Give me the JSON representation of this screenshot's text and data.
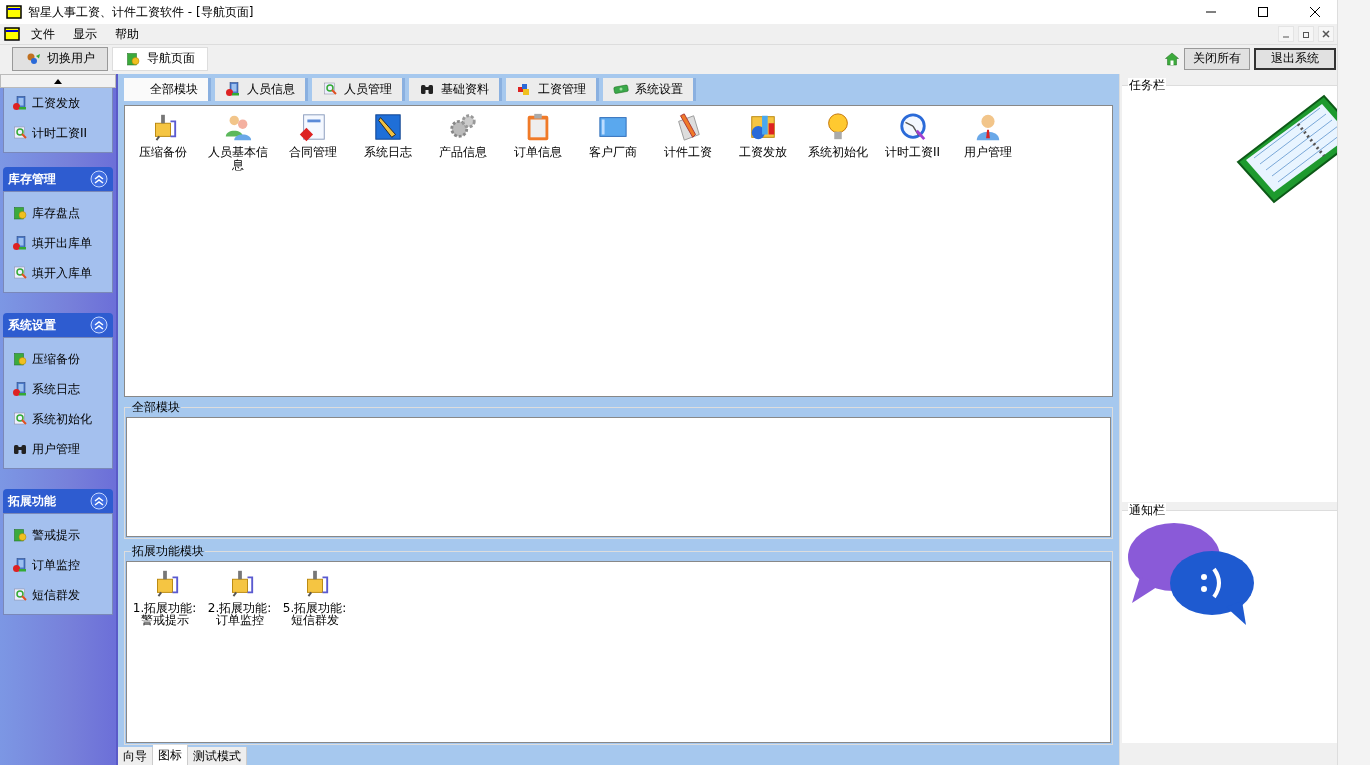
{
  "window": {
    "title": "智星人事工资、计件工资软件 - [导航页面]"
  },
  "menu": [
    "文件",
    "显示",
    "帮助"
  ],
  "toolbar": {
    "doc_tabs": [
      {
        "label": "切换用户",
        "kind": "switchuser",
        "selected": false
      },
      {
        "label": "导航页面",
        "kind": "package",
        "selected": true
      }
    ],
    "buttons": [
      "关闭所有",
      "退出系统"
    ]
  },
  "sidebar": {
    "partial_items": [
      {
        "label": "工资发放",
        "kind": "bank"
      },
      {
        "label": "计时工资II",
        "kind": "wrench"
      }
    ],
    "groups": [
      {
        "title": "库存管理",
        "expanded": true,
        "items": [
          {
            "label": "库存盘点",
            "kind": "package"
          },
          {
            "label": "填开出库单",
            "kind": "bank"
          },
          {
            "label": "填开入库单",
            "kind": "wrench"
          }
        ]
      },
      {
        "title": "系统设置",
        "expanded": true,
        "items": [
          {
            "label": "压缩备份",
            "kind": "package"
          },
          {
            "label": "系统日志",
            "kind": "bank"
          },
          {
            "label": "系统初始化",
            "kind": "wrench"
          },
          {
            "label": "用户管理",
            "kind": "binoculars"
          }
        ]
      },
      {
        "title": "拓展功能",
        "expanded": true,
        "items": [
          {
            "label": "警戒提示",
            "kind": "package"
          },
          {
            "label": "订单监控",
            "kind": "bank"
          },
          {
            "label": "短信群发",
            "kind": "wrench"
          }
        ]
      }
    ]
  },
  "module_tabs": [
    {
      "label": "全部模块",
      "kind": "none",
      "selected": true
    },
    {
      "label": "人员信息",
      "kind": "bank",
      "selected": false
    },
    {
      "label": "人员管理",
      "kind": "wrench",
      "selected": false
    },
    {
      "label": "基础资料",
      "kind": "binoculars",
      "selected": false
    },
    {
      "label": "工资管理",
      "kind": "colors",
      "selected": false
    },
    {
      "label": "系统设置",
      "kind": "cash",
      "selected": false
    }
  ],
  "modules": [
    {
      "label": "压缩备份",
      "kind": "backup"
    },
    {
      "label": "人员基本信息",
      "kind": "people"
    },
    {
      "label": "合同管理",
      "kind": "abc"
    },
    {
      "label": "系统日志",
      "kind": "pen"
    },
    {
      "label": "产品信息",
      "kind": "gears"
    },
    {
      "label": "订单信息",
      "kind": "clipboard"
    },
    {
      "label": "客户厂商",
      "kind": "panel"
    },
    {
      "label": "计件工资",
      "kind": "pencil"
    },
    {
      "label": "工资发放",
      "kind": "chart"
    },
    {
      "label": "系统初始化",
      "kind": "bulb"
    },
    {
      "label": "计时工资II",
      "kind": "clock"
    },
    {
      "label": "用户管理",
      "kind": "user"
    }
  ],
  "all_modules_group": {
    "title": "全部模块"
  },
  "extension_group": {
    "title": "拓展功能模块",
    "items": [
      {
        "label_lines": [
          "1.拓展功能:",
          "警戒提示"
        ],
        "kind": "backup"
      },
      {
        "label_lines": [
          "2.拓展功能:",
          "订单监控"
        ],
        "kind": "backup"
      },
      {
        "label_lines": [
          "5.拓展功能:",
          "短信群发"
        ],
        "kind": "backup"
      }
    ]
  },
  "bottom_tabs": [
    {
      "label": "向导",
      "selected": false
    },
    {
      "label": "图标",
      "selected": true
    },
    {
      "label": "测试模式",
      "selected": false
    }
  ],
  "task_panel": {
    "title": "任务栏"
  },
  "notice_panel": {
    "title": "通知栏"
  }
}
